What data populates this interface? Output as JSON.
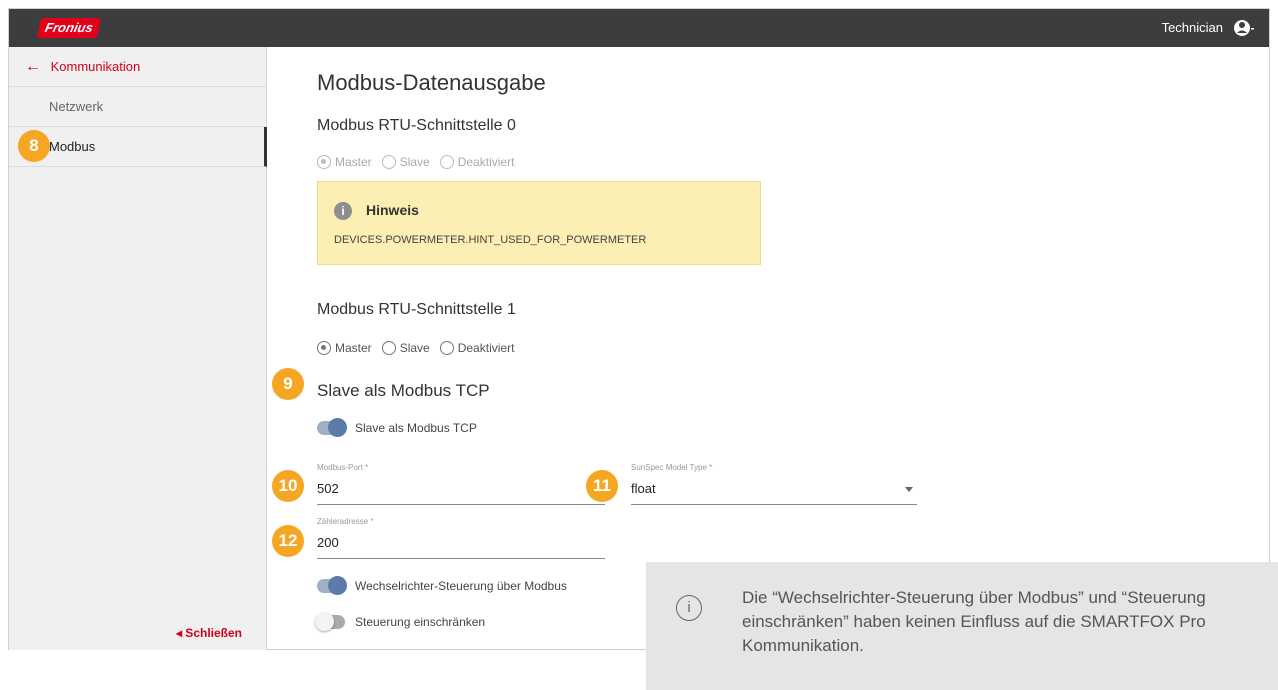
{
  "app": {
    "logo": "Fronius",
    "user": "Technician"
  },
  "sidebar": {
    "back_label": "Kommunikation",
    "items": [
      {
        "label": "Netzwerk"
      },
      {
        "label": "Modbus"
      }
    ],
    "close_label": "◂ Schließen"
  },
  "main": {
    "title": "Modbus-Datenausgabe",
    "rtu0": {
      "title": "Modbus RTU-Schnittstelle 0",
      "options": [
        "Master",
        "Slave",
        "Deaktiviert"
      ],
      "selected": "Master"
    },
    "hint": {
      "title": "Hinweis",
      "text": "DEVICES.POWERMETER.HINT_USED_FOR_POWERMETER"
    },
    "rtu1": {
      "title": "Modbus RTU-Schnittstelle 1",
      "options": [
        "Master",
        "Slave",
        "Deaktiviert"
      ],
      "selected": "Master"
    },
    "tcp": {
      "title": "Slave als Modbus TCP",
      "toggle_label": "Slave als Modbus TCP",
      "toggle_on": true
    },
    "port": {
      "label": "Modbus-Port *",
      "value": "502"
    },
    "model": {
      "label": "SunSpec Model Type *",
      "value": "float"
    },
    "meter": {
      "label": "Zähleradresse *",
      "value": "200"
    },
    "inverter_control": {
      "label": "Wechselrichter-Steuerung über Modbus",
      "on": true
    },
    "restrict_control": {
      "label": "Steuerung einschränken",
      "on": false
    }
  },
  "badges": {
    "b8": "8",
    "b9": "9",
    "b10": "10",
    "b11": "11",
    "b12": "12"
  },
  "note": {
    "text": "Die “Wechselrichter-Steuerung über Modbus” und “Steuerung einschränken” haben keinen Einfluss auf die SMARTFOX Pro Kommunikation."
  },
  "colors": {
    "accent": "#d0021b",
    "badge": "#f5a623",
    "topbar": "#3d3d3d",
    "toggle": "#5c7ba8",
    "hint_bg": "#fcefb4"
  }
}
